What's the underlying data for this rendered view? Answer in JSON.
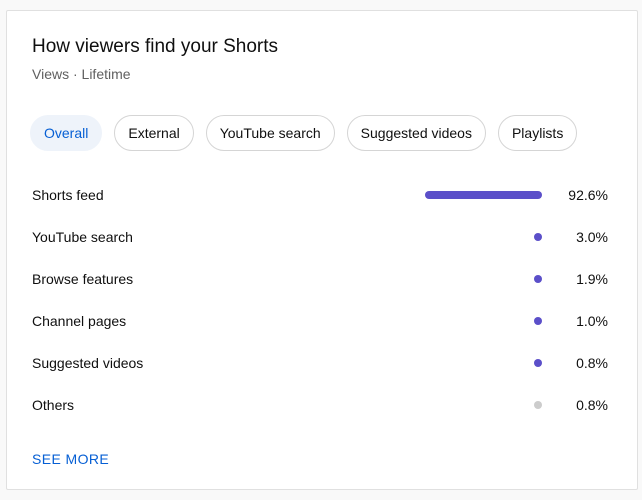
{
  "card": {
    "title": "How viewers find your Shorts",
    "subtitle": "Views · Lifetime"
  },
  "tabs": [
    {
      "label": "Overall",
      "active": true
    },
    {
      "label": "External",
      "active": false
    },
    {
      "label": "YouTube search",
      "active": false
    },
    {
      "label": "Suggested videos",
      "active": false
    },
    {
      "label": "Playlists",
      "active": false
    }
  ],
  "sources": [
    {
      "label": "Shorts feed",
      "value": "92.6%",
      "percent": 92.6,
      "color": "#5b4fc9"
    },
    {
      "label": "YouTube search",
      "value": "3.0%",
      "percent": 3.0,
      "color": "#5b4fc9"
    },
    {
      "label": "Browse features",
      "value": "1.9%",
      "percent": 1.9,
      "color": "#5b4fc9"
    },
    {
      "label": "Channel pages",
      "value": "1.0%",
      "percent": 1.0,
      "color": "#5b4fc9"
    },
    {
      "label": "Suggested videos",
      "value": "0.8%",
      "percent": 0.8,
      "color": "#5b4fc9"
    },
    {
      "label": "Others",
      "value": "0.8%",
      "percent": 0.8,
      "color": "#cccccc"
    }
  ],
  "actions": {
    "see_more": "SEE MORE"
  },
  "colors": {
    "accent": "#065fd4",
    "bar": "#5b4fc9",
    "others_bar": "#cccccc",
    "active_chip_bg": "#eef3fa"
  }
}
